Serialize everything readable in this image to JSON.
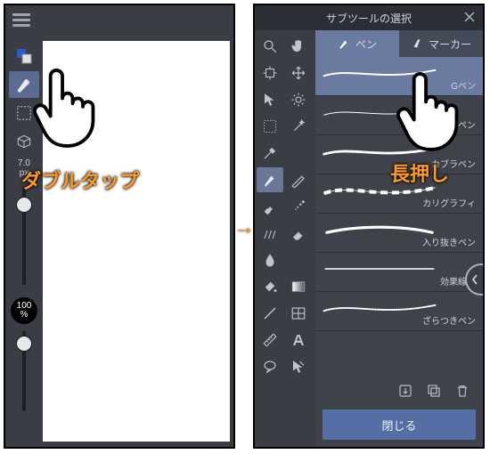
{
  "left": {
    "brush_size_value": "7.0",
    "brush_size_unit": "px",
    "zoom_value": "100",
    "zoom_unit": "%"
  },
  "right": {
    "header_title": "サブツールの選択",
    "tabs": {
      "pen": "ペン",
      "marker": "マーカー"
    },
    "brushes": [
      {
        "name": "Gペン"
      },
      {
        "name": "丸ペン"
      },
      {
        "name": "カブラペン"
      },
      {
        "name": "カリグラフィ"
      },
      {
        "name": "入り抜きペン"
      },
      {
        "name": "効果線用"
      },
      {
        "name": "ざらつきペン"
      }
    ],
    "close_label": "閉じる"
  },
  "overlay": {
    "left_annotation": "ダブルタップ",
    "right_annotation": "長押し"
  }
}
